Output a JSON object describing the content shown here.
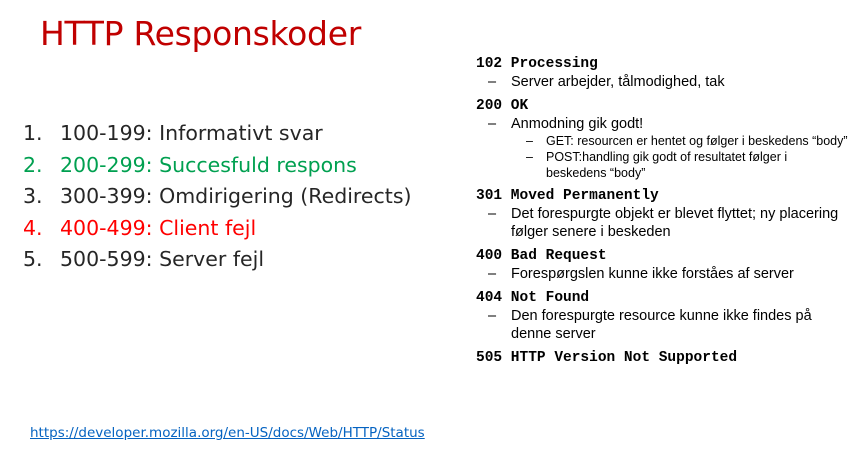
{
  "title": "HTTP Responskoder",
  "ranges": [
    {
      "num": "1.",
      "text": "100-199: Informativt svar",
      "color": "#262626"
    },
    {
      "num": "2.",
      "text": "200-299: Succesfuld respons",
      "color": "#00A050"
    },
    {
      "num": "3.",
      "text": "300-399: Omdirigering (Redirects)",
      "color": "#262626"
    },
    {
      "num": "4.",
      "text": "400-499: Client fejl",
      "color": "#FF0000"
    },
    {
      "num": "5.",
      "text": "500-599: Server fejl",
      "color": "#262626"
    }
  ],
  "link": "https://developer.mozilla.org/en-US/docs/Web/HTTP/Status",
  "codes": [
    {
      "head": "102 Processing",
      "bullets": [
        "Server arbejder, tålmodighed, tak"
      ]
    },
    {
      "head": "200 OK",
      "bullets": [
        "Anmodning gik godt!"
      ],
      "subs": [
        "GET: resourcen er hentet og følger i beskedens “body”",
        "POST:handling gik godt of resultatet følger i beskedens “body”"
      ]
    },
    {
      "head": "301 Moved Permanently",
      "bullets": [
        "Det forespurgte objekt er blevet flyttet; ny placering følger senere i beskeden"
      ]
    },
    {
      "head": "400 Bad Request",
      "bullets": [
        "Forespørgslen kunne ikke forståes af server"
      ]
    },
    {
      "head": "404 Not Found",
      "bullets": [
        "Den forespurgte resource kunne ikke findes på denne server"
      ]
    },
    {
      "head": "505 HTTP Version Not Supported",
      "bullets": []
    }
  ],
  "dash": "–"
}
